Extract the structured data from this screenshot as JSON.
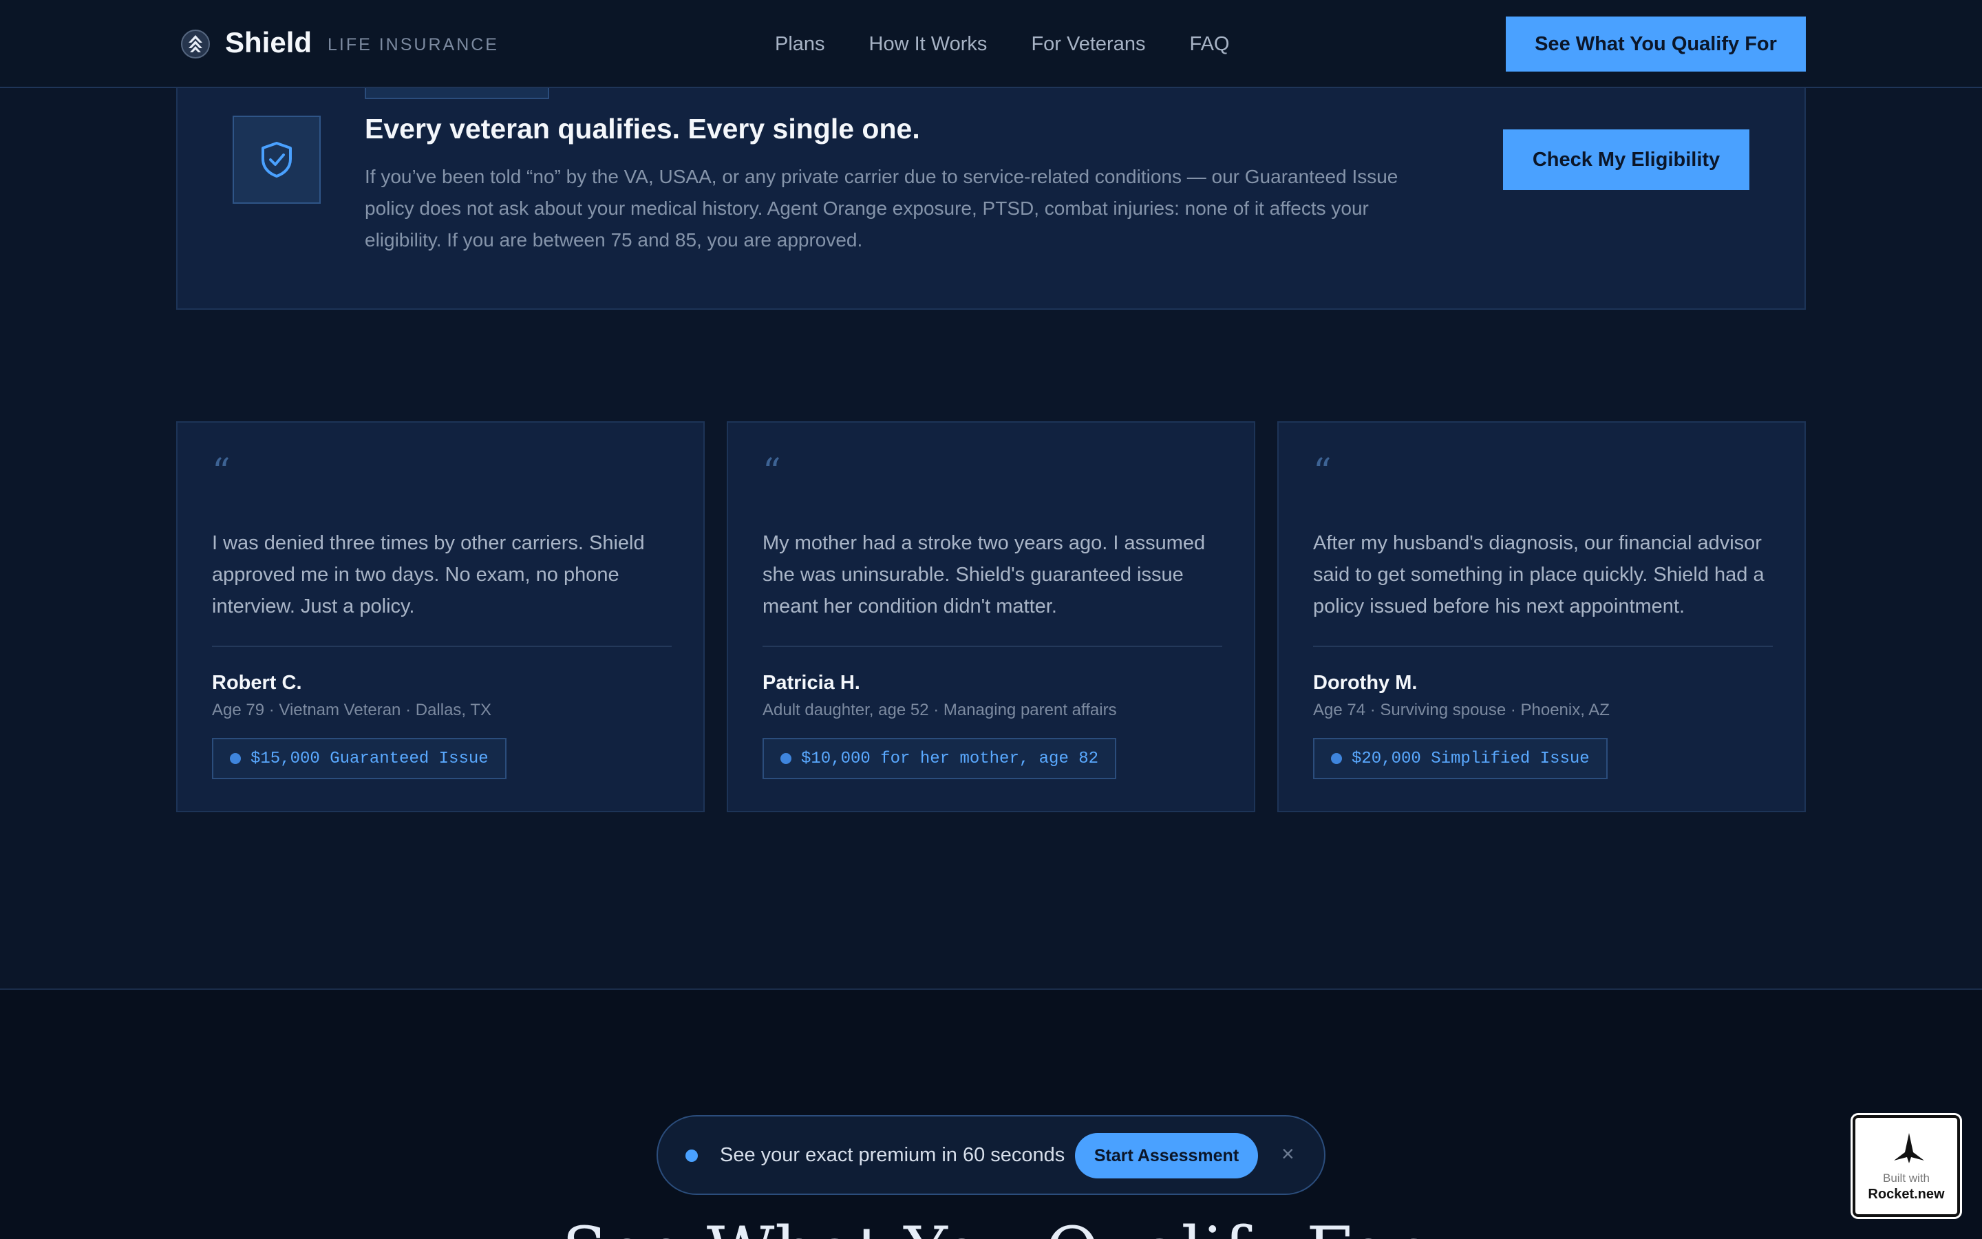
{
  "header": {
    "brand": "Shield",
    "brand_sub": "LIFE INSURANCE",
    "nav": [
      "Plans",
      "How It Works",
      "For Veterans",
      "FAQ"
    ],
    "cta": "See What You Qualify For"
  },
  "veteran": {
    "title": "Every veteran qualifies. Every single one.",
    "body": "If you’ve been told “no” by the VA, USAA, or any private carrier due to service-related conditions — our Guaranteed Issue policy does not ask about your medical history. Agent Orange exposure, PTSD, combat injuries: none of it affects your eligibility. If you are between 75 and 85, you are approved.",
    "cta": "Check My Eligibility",
    "icon": "shield-check-icon"
  },
  "testimonials": [
    {
      "quote_mark": "“",
      "quote": "I was denied three times by other carriers. Shield approved me in two days. No exam, no phone interview. Just a policy.",
      "name": "Robert C.",
      "meta": "Age 79 · Vietnam Veteran · Dallas, TX",
      "badge": "$15,000 Guaranteed Issue"
    },
    {
      "quote_mark": "“",
      "quote": "My mother had a stroke two years ago. I assumed she was uninsurable. Shield's guaranteed issue meant her condition didn't matter.",
      "name": "Patricia H.",
      "meta": "Adult daughter, age 52 · Managing parent affairs",
      "badge": "$10,000 for her mother, age 82"
    },
    {
      "quote_mark": "“",
      "quote": "After my husband's diagnosis, our financial advisor said to get something in place quickly. Shield had a policy issued before his next appointment.",
      "name": "Dorothy M.",
      "meta": "Age 74 · Surviving spouse · Phoenix, AZ",
      "badge": "$20,000 Simplified Issue"
    }
  ],
  "bottom": {
    "heading": "See What You Qualify For"
  },
  "floating_bar": {
    "text": "See your exact premium in 60 seconds",
    "cta": "Start Assessment",
    "close": "×"
  },
  "rocket_badge": {
    "small": "Built with",
    "big": "Rocket.new"
  },
  "colors": {
    "accent": "#4aa1ff",
    "background": "#0b1629",
    "card": "#112240"
  }
}
